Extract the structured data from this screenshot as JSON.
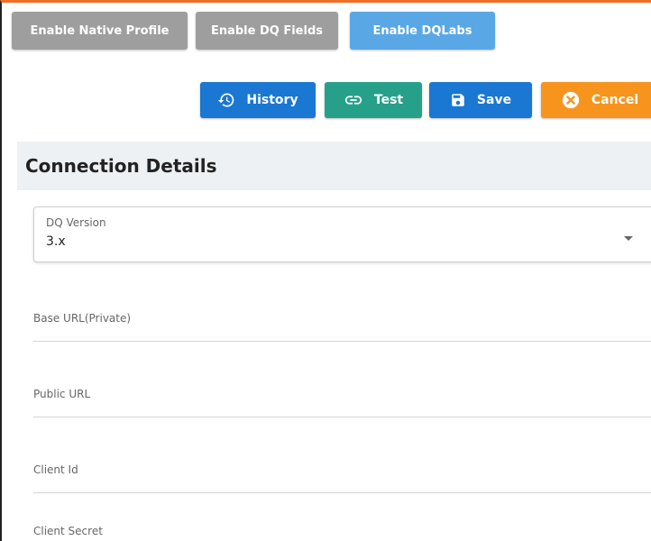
{
  "toggles": {
    "native_profile": "Enable Native Profile",
    "dq_fields": "Enable DQ Fields",
    "dqlabs": "Enable DQLabs"
  },
  "actions": {
    "history": "History",
    "test": "Test",
    "save": "Save",
    "cancel": "Cancel"
  },
  "icons": {
    "history": "history-icon",
    "test": "link-icon",
    "save": "floppy-disk-icon",
    "cancel": "close-circle-icon",
    "select_arrow": "caret-down-icon"
  },
  "section": {
    "title": "Connection Details"
  },
  "form": {
    "dq_version": {
      "label": "DQ Version",
      "value": "3.x"
    },
    "base_url": {
      "placeholder": "Base URL(Private)"
    },
    "public_url": {
      "placeholder": "Public URL"
    },
    "client_id": {
      "placeholder": "Client Id"
    },
    "client_secret": {
      "placeholder": "Client Secret"
    }
  },
  "colors": {
    "top_border": "#ec7126",
    "toggle_inactive": "#9e9e9e",
    "toggle_active": "#5aa7e6",
    "primary_blue": "#1a77d2",
    "test_teal": "#27a08a",
    "cancel_orange": "#f6941e",
    "section_bg": "#eef1f4"
  }
}
